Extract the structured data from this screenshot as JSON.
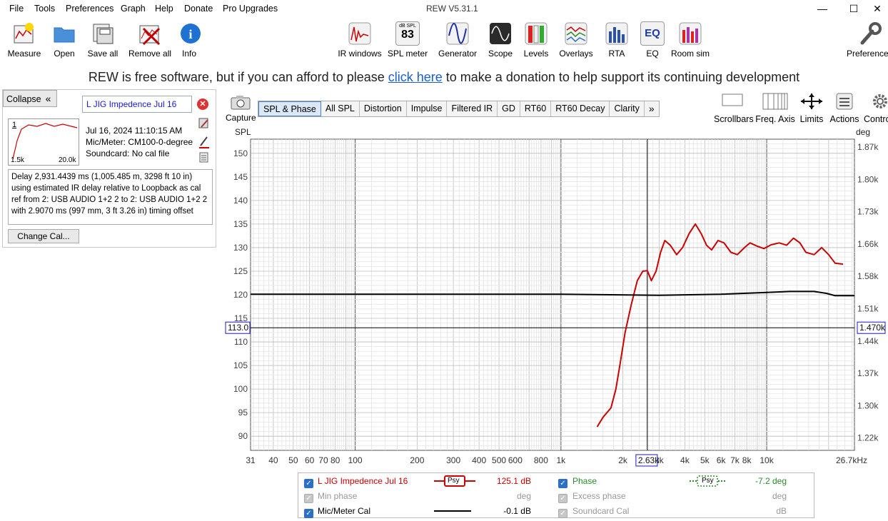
{
  "menubar": {
    "items": [
      "File",
      "Tools",
      "Preferences",
      "Graph",
      "Help",
      "Donate",
      "Pro Upgrades"
    ],
    "title": "REW V5.31.1"
  },
  "toolbar": {
    "left": [
      {
        "label": "Measure",
        "icon": "measure-icon"
      },
      {
        "label": "Open",
        "icon": "folder-icon"
      },
      {
        "label": "Save all",
        "icon": "save-icon"
      },
      {
        "label": "Remove all",
        "icon": "remove-icon"
      },
      {
        "label": "Info",
        "icon": "info-icon"
      }
    ],
    "center": [
      {
        "label": "IR windows",
        "icon": "ir-windows-icon"
      },
      {
        "label": "SPL meter",
        "icon": "spl-meter-icon",
        "badge": "dB SPL",
        "value": "83"
      },
      {
        "label": "Generator",
        "icon": "generator-icon"
      },
      {
        "label": "Scope",
        "icon": "scope-icon"
      },
      {
        "label": "Levels",
        "icon": "levels-icon"
      },
      {
        "label": "Overlays",
        "icon": "overlays-icon"
      },
      {
        "label": "RTA",
        "icon": "rta-icon"
      },
      {
        "label": "EQ",
        "icon": "eq-icon",
        "glyph": "EQ"
      },
      {
        "label": "Room sim",
        "icon": "room-sim-icon"
      }
    ],
    "right": {
      "label": "Preferences",
      "icon": "wrench-icon"
    }
  },
  "donate": {
    "before": "REW is free software, but if you can afford to please ",
    "link": "click here",
    "after": " to make a donation to help support its continuing development"
  },
  "panel": {
    "collapse": "Collapse",
    "name": "L JIG Impedence Jul 16",
    "thumb_marker": "1",
    "thumb_min": "1.5k",
    "thumb_max": "20.0k",
    "date": "Jul 16, 2024 11:10:15 AM",
    "mic": "Mic/Meter: CM100-0-degree",
    "soundcard": "Soundcard: No cal file",
    "notes": "Delay 2,931.4439 ms (1,005.485 m, 3298 ft 10 in) using estimated IR delay relative to Loopback as cal ref from 2: USB AUDIO 1+2 2 to 2: USB AUDIO 1+2 2 with 2.9070 ms (997 mm, 3 ft 3.26 in) timing offset",
    "change_cal": "Change Cal..."
  },
  "capture": "Capture",
  "tabs": [
    "SPL & Phase",
    "All SPL",
    "Distortion",
    "Impulse",
    "Filtered IR",
    "GD",
    "RT60",
    "RT60 Decay",
    "Clarity",
    "»"
  ],
  "active_tab": "SPL & Phase",
  "right_tools": [
    {
      "label": "Scrollbars",
      "icon": "scrollbars-icon"
    },
    {
      "label": "Freq. Axis",
      "icon": "freq-axis-icon"
    },
    {
      "label": "Limits",
      "icon": "limits-icon"
    },
    {
      "label": "Actions",
      "icon": "actions-icon"
    },
    {
      "label": "Contro",
      "icon": "gear-icon"
    }
  ],
  "colors": {
    "spl": "#cc0000",
    "cal": "#000000",
    "phase": "#2a8a2a",
    "accent": "#2b6fc9",
    "cursor_box": "#1a1acc"
  },
  "chart_data": {
    "type": "line",
    "ylabel_left": "SPL",
    "ylabel_right": "deg",
    "x_unit": "Hz",
    "xscale": "log",
    "xlim": [
      31,
      26700
    ],
    "ylim": [
      87,
      153
    ],
    "yticks_left": [
      150,
      145,
      140,
      135,
      130,
      125,
      120,
      115,
      110,
      105,
      100,
      95,
      90
    ],
    "yticks_right": [
      "1.87k",
      "1.80k",
      "1.73k",
      "1.66k",
      "1.58k",
      "1.51k",
      "1.44k",
      "1.37k",
      "1.30k",
      "1.22k"
    ],
    "xticks": [
      "31",
      "40",
      "50",
      "60",
      "70",
      "80",
      "100",
      "200",
      "300",
      "400",
      "500",
      "600",
      "800",
      "1k",
      "2k",
      "3k",
      "4k",
      "5k",
      "6k",
      "7k",
      "8k",
      "10k",
      "26.7kHz"
    ],
    "cursor": {
      "x_label": "2.63k",
      "y_left": "113.0",
      "y_right": "1.470k",
      "x": 2630,
      "y": 113
    },
    "series": [
      {
        "name": "L JIG Impedence Jul 16",
        "color": "#cc0000",
        "points": [
          [
            1500,
            92
          ],
          [
            1600,
            94
          ],
          [
            1750,
            96
          ],
          [
            1850,
            100
          ],
          [
            1950,
            106
          ],
          [
            2050,
            112
          ],
          [
            2200,
            118
          ],
          [
            2350,
            123
          ],
          [
            2500,
            125
          ],
          [
            2630,
            125.1
          ],
          [
            2750,
            123
          ],
          [
            2900,
            125
          ],
          [
            3050,
            129
          ],
          [
            3200,
            131.5
          ],
          [
            3400,
            130.5
          ],
          [
            3650,
            128.5
          ],
          [
            3900,
            130
          ],
          [
            4200,
            133
          ],
          [
            4500,
            135
          ],
          [
            4800,
            133
          ],
          [
            5100,
            130.5
          ],
          [
            5400,
            129.5
          ],
          [
            5800,
            131.5
          ],
          [
            6200,
            131
          ],
          [
            6700,
            129
          ],
          [
            7200,
            128.5
          ],
          [
            7800,
            130
          ],
          [
            8300,
            131
          ],
          [
            9000,
            130.3
          ],
          [
            9700,
            129.8
          ],
          [
            10500,
            130.6
          ],
          [
            11500,
            131
          ],
          [
            12500,
            130.5
          ],
          [
            13500,
            132
          ],
          [
            14500,
            131
          ],
          [
            15500,
            129
          ],
          [
            17000,
            128.5
          ],
          [
            18500,
            130
          ],
          [
            20000,
            128.5
          ],
          [
            21500,
            126.7
          ],
          [
            23500,
            126.5
          ]
        ]
      },
      {
        "name": "Mic/Meter Cal",
        "color": "#000000",
        "points": [
          [
            31,
            120.1
          ],
          [
            1000,
            120.1
          ],
          [
            3000,
            119.9
          ],
          [
            6000,
            120.1
          ],
          [
            10000,
            120.5
          ],
          [
            13000,
            120.7
          ],
          [
            17000,
            120.7
          ],
          [
            19500,
            120.3
          ],
          [
            21500,
            119.8
          ],
          [
            26700,
            119.8
          ]
        ]
      }
    ]
  },
  "legend": {
    "rows": [
      {
        "left": {
          "label": "L JIG Impedence Jul 16",
          "value": "125.1 dB",
          "psy": "Psy",
          "checked": true,
          "color": "#cc0000"
        },
        "right": {
          "label": "Phase",
          "value": "-7.2 deg",
          "psy": "Psy",
          "checked": true,
          "color": "#2a8a2a"
        }
      },
      {
        "left": {
          "label": "Min phase",
          "value": "deg",
          "checked": true,
          "disabled": true
        },
        "right": {
          "label": "Excess phase",
          "value": "deg",
          "checked": true,
          "disabled": true
        }
      },
      {
        "left": {
          "label": "Mic/Meter Cal",
          "value": "-0.1 dB",
          "checked": true,
          "color": "#000000"
        },
        "right": {
          "label": "Soundcard Cal",
          "value": "dB",
          "checked": true,
          "disabled": true
        }
      }
    ]
  }
}
